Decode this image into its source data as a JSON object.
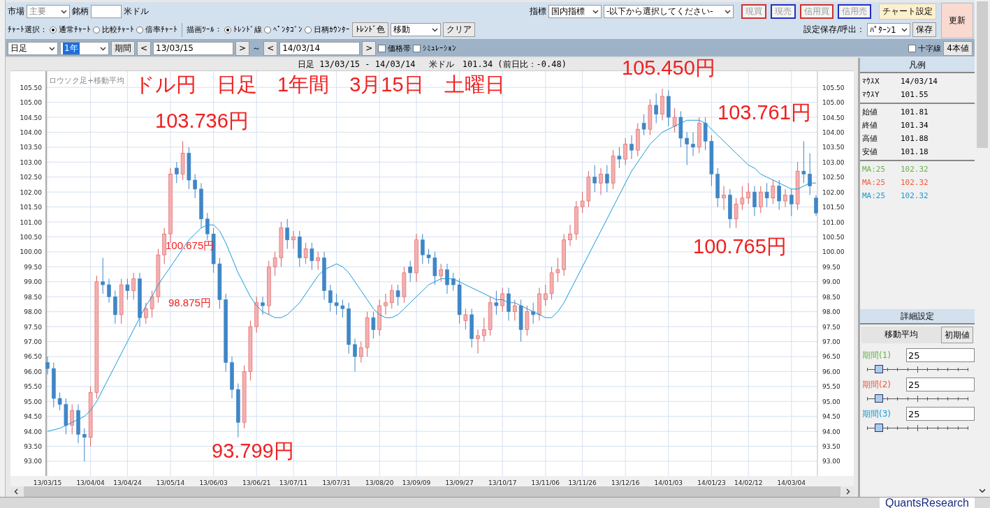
{
  "toolbar": {
    "market_label": "市場",
    "market": {
      "value": "主要",
      "disabled": true
    },
    "symbol_label": "銘柄",
    "symbol_name": "米ドル",
    "indicator_label": "指標",
    "indicator_selects": [
      "国内指標",
      "-以下から選択してください-"
    ],
    "trade_buttons": [
      {
        "label": "現買",
        "color": "#d03030",
        "disabled": true
      },
      {
        "label": "現売",
        "color": "#2030c0",
        "disabled": true
      },
      {
        "label": "信用買",
        "color": "#d03030",
        "disabled": true
      },
      {
        "label": "信用売",
        "color": "#2030c0",
        "disabled": true
      }
    ],
    "chart_settings_button": "チャート設定",
    "refresh_button": "更新",
    "chart_select": {
      "label": "ﾁｬｰﾄ選択：",
      "options": [
        {
          "label": "通常ﾁｬｰﾄ",
          "selected": true
        },
        {
          "label": "比較ﾁｬｰﾄ",
          "selected": false
        },
        {
          "label": "倍率ﾁｬｰﾄ",
          "selected": false
        }
      ]
    },
    "draw_tool": {
      "label": "描画ﾂｰﾙ：",
      "options": [
        {
          "label": "ﾄﾚﾝﾄﾞ線",
          "selected": true
        },
        {
          "label": "ﾍﾟﾝﾀｺﾞﾝ",
          "selected": false
        },
        {
          "label": "日柄ｶｳﾝﾀｰ",
          "selected": false
        }
      ]
    },
    "trend_color_button": "ﾄﾚﾝﾄﾞ色",
    "mode_select": "移動",
    "clear_button": "クリア",
    "save_label": "設定保存/呼出：",
    "pattern_select": "ﾊﾟﾀｰﾝ1",
    "save_button": "保存",
    "interval_select": {
      "value": "日足",
      "highlighted": false
    },
    "span_select": {
      "value": "1年",
      "highlighted": true
    },
    "period_button": "期間",
    "prev_button": "<",
    "start_date": "13/03/15",
    "next_button": ">",
    "range_sep": "～",
    "start2_button": "<",
    "end_date": "14/03/14",
    "end2_button": ">",
    "checkboxes": [
      {
        "label": "価格帯",
        "checked": false
      },
      {
        "label": "ｼﾐｭﾚｰｼｮﾝ",
        "checked": false
      }
    ],
    "crosshair": {
      "label": "十字線",
      "checked": false
    },
    "ohlc_button": "4本値"
  },
  "chart": {
    "header": "日足 13/03/15 - 14/03/14　 米ドル　101.34 (前日比：-0.48)",
    "caption": "ロウソク足+移動平均",
    "chart_data": {
      "type": "candlestick",
      "ylim": [
        92.51,
        106.04
      ],
      "categories": [
        "13/03/15",
        null,
        null,
        null,
        null,
        null,
        null,
        "13/04/04",
        null,
        null,
        null,
        null,
        null,
        "13/04/24",
        null,
        null,
        null,
        null,
        null,
        null,
        "13/05/14",
        null,
        null,
        null,
        null,
        null,
        null,
        "13/06/03",
        null,
        null,
        null,
        null,
        null,
        null,
        "13/06/21",
        null,
        null,
        null,
        null,
        null,
        "13/07/11",
        null,
        null,
        null,
        null,
        null,
        null,
        "13/07/31",
        null,
        null,
        null,
        null,
        null,
        null,
        "13/08/20",
        null,
        null,
        null,
        null,
        null,
        "13/09/09",
        null,
        null,
        null,
        null,
        null,
        null,
        "13/09/27",
        null,
        null,
        null,
        null,
        null,
        null,
        "13/10/17",
        null,
        null,
        null,
        null,
        null,
        null,
        "13/11/06",
        null,
        null,
        null,
        null,
        null,
        "13/11/26",
        null,
        null,
        null,
        null,
        null,
        null,
        "13/12/16",
        null,
        null,
        null,
        null,
        null,
        null,
        "14/01/03",
        null,
        null,
        null,
        null,
        null,
        null,
        "14/01/23",
        null,
        null,
        null,
        null,
        null,
        "14/02/12",
        null,
        null,
        null,
        null,
        null,
        null,
        "14/03/04",
        null,
        null,
        null,
        null
      ],
      "ohlc": [
        [
          96.3,
          96.5,
          95.9,
          96.1
        ],
        [
          96.1,
          96.3,
          94.8,
          95.1
        ],
        [
          95.1,
          95.3,
          94.7,
          94.9
        ],
        [
          94.9,
          95.1,
          93.9,
          94.2
        ],
        [
          94.2,
          94.9,
          93.9,
          94.7
        ],
        [
          94.7,
          94.9,
          93.6,
          93.9
        ],
        [
          93.9,
          94.1,
          93.0,
          93.8
        ],
        [
          93.8,
          95.5,
          93.5,
          95.3
        ],
        [
          95.3,
          99.2,
          95.1,
          99.0
        ],
        [
          99.0,
          99.8,
          98.6,
          98.9
        ],
        [
          98.9,
          99.1,
          98.3,
          98.5
        ],
        [
          98.5,
          98.7,
          97.6,
          97.9
        ],
        [
          97.9,
          99.1,
          97.6,
          98.9
        ],
        [
          98.9,
          99.1,
          98.4,
          98.7
        ],
        [
          98.7,
          99.3,
          98.4,
          99.1
        ],
        [
          99.1,
          99.3,
          97.5,
          97.8
        ],
        [
          97.8,
          98.3,
          97.6,
          98.1
        ],
        [
          98.1,
          98.7,
          97.8,
          98.5
        ],
        [
          98.5,
          100.1,
          98.3,
          99.9
        ],
        [
          99.9,
          100.8,
          99.6,
          100.6
        ],
        [
          100.6,
          102.8,
          100.3,
          102.6
        ],
        [
          102.8,
          103.0,
          102.3,
          102.6
        ],
        [
          102.6,
          103.7,
          102.4,
          103.3
        ],
        [
          103.3,
          103.5,
          102.1,
          102.4
        ],
        [
          102.4,
          102.6,
          101.8,
          102.1
        ],
        [
          102.1,
          102.3,
          100.8,
          101.1
        ],
        [
          101.1,
          101.3,
          100.4,
          100.6
        ],
        [
          100.6,
          100.8,
          99.3,
          99.6
        ],
        [
          99.6,
          99.8,
          98.1,
          98.4
        ],
        [
          98.4,
          98.6,
          96.0,
          96.3
        ],
        [
          96.3,
          96.5,
          95.1,
          95.4
        ],
        [
          95.4,
          95.6,
          93.8,
          94.3
        ],
        [
          94.3,
          96.2,
          94.1,
          96.0
        ],
        [
          96.0,
          97.7,
          95.7,
          97.5
        ],
        [
          97.5,
          98.5,
          97.3,
          98.3
        ],
        [
          98.3,
          98.5,
          97.9,
          98.2
        ],
        [
          98.2,
          99.7,
          97.9,
          99.5
        ],
        [
          99.5,
          100.0,
          99.2,
          99.8
        ],
        [
          99.8,
          101.0,
          99.5,
          100.8
        ],
        [
          100.8,
          101.1,
          100.1,
          100.4
        ],
        [
          100.4,
          100.7,
          100.1,
          100.5
        ],
        [
          100.5,
          100.7,
          99.5,
          99.8
        ],
        [
          99.8,
          100.3,
          99.6,
          100.1
        ],
        [
          100.1,
          100.3,
          99.4,
          99.7
        ],
        [
          99.7,
          100.0,
          99.4,
          99.8
        ],
        [
          99.8,
          100.0,
          98.4,
          98.7
        ],
        [
          98.7,
          98.9,
          98.0,
          98.3
        ],
        [
          98.3,
          98.6,
          97.9,
          98.2
        ],
        [
          98.2,
          98.4,
          97.8,
          98.1
        ],
        [
          98.1,
          98.3,
          96.6,
          96.9
        ],
        [
          96.9,
          97.1,
          96.0,
          96.5
        ],
        [
          96.5,
          97.0,
          96.3,
          96.8
        ],
        [
          96.8,
          98.0,
          96.5,
          97.8
        ],
        [
          97.8,
          98.0,
          97.1,
          97.4
        ],
        [
          97.4,
          98.4,
          97.2,
          98.2
        ],
        [
          98.2,
          98.6,
          97.9,
          98.3
        ],
        [
          98.3,
          98.9,
          98.1,
          98.7
        ],
        [
          98.7,
          98.9,
          98.2,
          98.5
        ],
        [
          98.5,
          99.5,
          98.3,
          99.3
        ],
        [
          99.5,
          99.7,
          99.0,
          99.3
        ],
        [
          99.3,
          100.6,
          99.0,
          100.4
        ],
        [
          100.4,
          100.6,
          99.6,
          99.9
        ],
        [
          99.9,
          100.1,
          99.6,
          99.8
        ],
        [
          99.8,
          100.0,
          98.9,
          99.2
        ],
        [
          99.2,
          99.6,
          99.0,
          99.4
        ],
        [
          99.4,
          99.6,
          98.6,
          98.9
        ],
        [
          99.1,
          99.3,
          98.7,
          98.9
        ],
        [
          98.9,
          99.1,
          97.6,
          97.9
        ],
        [
          97.7,
          98.1,
          97.4,
          97.9
        ],
        [
          97.9,
          98.1,
          96.8,
          97.1
        ],
        [
          97.1,
          97.4,
          96.6,
          97.2
        ],
        [
          97.2,
          97.8,
          97.0,
          97.4
        ],
        [
          97.4,
          98.5,
          97.2,
          98.3
        ],
        [
          98.3,
          98.7,
          97.9,
          98.2
        ],
        [
          98.2,
          98.8,
          98.0,
          98.6
        ],
        [
          98.6,
          98.8,
          97.7,
          98.0
        ],
        [
          98.0,
          98.4,
          97.7,
          98.2
        ],
        [
          98.2,
          98.4,
          97.0,
          97.4
        ],
        [
          97.4,
          98.2,
          97.2,
          98.0
        ],
        [
          98.0,
          98.3,
          97.6,
          97.9
        ],
        [
          97.9,
          98.8,
          97.7,
          98.6
        ],
        [
          98.4,
          98.9,
          98.2,
          98.6
        ],
        [
          98.6,
          99.5,
          98.4,
          99.3
        ],
        [
          99.3,
          99.8,
          99.0,
          99.4
        ],
        [
          99.4,
          100.6,
          99.2,
          100.4
        ],
        [
          100.4,
          100.9,
          100.2,
          100.6
        ],
        [
          100.6,
          101.7,
          100.4,
          101.5
        ],
        [
          101.5,
          102.0,
          101.3,
          101.7
        ],
        [
          101.7,
          102.7,
          101.5,
          102.5
        ],
        [
          102.5,
          102.9,
          102.0,
          102.3
        ],
        [
          102.3,
          102.8,
          101.9,
          102.6
        ],
        [
          102.6,
          102.9,
          102.0,
          102.3
        ],
        [
          102.3,
          103.4,
          102.1,
          103.2
        ],
        [
          103.2,
          103.5,
          102.8,
          103.1
        ],
        [
          103.1,
          103.8,
          102.9,
          103.6
        ],
        [
          103.6,
          103.9,
          103.1,
          103.4
        ],
        [
          103.4,
          104.3,
          103.2,
          104.1
        ],
        [
          104.3,
          104.6,
          103.9,
          104.1
        ],
        [
          104.1,
          105.1,
          103.9,
          104.9
        ],
        [
          104.9,
          105.3,
          104.3,
          104.6
        ],
        [
          104.6,
          105.45,
          104.4,
          105.2
        ],
        [
          105.2,
          105.4,
          104.2,
          104.5
        ],
        [
          104.2,
          104.8,
          104.0,
          104.5
        ],
        [
          104.5,
          104.7,
          103.5,
          103.8
        ],
        [
          103.8,
          104.0,
          102.9,
          103.6
        ],
        [
          103.6,
          104.0,
          103.2,
          103.5
        ],
        [
          103.5,
          104.5,
          103.3,
          104.3
        ],
        [
          104.3,
          104.5,
          103.4,
          103.7
        ],
        [
          103.7,
          103.9,
          102.2,
          102.6
        ],
        [
          102.6,
          102.8,
          101.5,
          101.8
        ],
        [
          101.8,
          102.2,
          101.4,
          101.9
        ],
        [
          101.9,
          102.1,
          100.8,
          101.1
        ],
        [
          101.1,
          101.8,
          100.8,
          101.6
        ],
        [
          101.6,
          102.2,
          101.4,
          101.8
        ],
        [
          101.8,
          102.3,
          101.6,
          102.0
        ],
        [
          102.0,
          102.2,
          101.2,
          101.5
        ],
        [
          101.5,
          102.2,
          101.3,
          102.0
        ],
        [
          102.0,
          102.3,
          101.5,
          101.8
        ],
        [
          101.8,
          102.4,
          101.6,
          102.2
        ],
        [
          102.2,
          102.4,
          101.4,
          101.7
        ],
        [
          101.7,
          102.1,
          101.5,
          101.9
        ],
        [
          101.9,
          102.1,
          101.2,
          101.6
        ],
        [
          101.6,
          103.0,
          101.4,
          102.7
        ],
        [
          102.7,
          103.7,
          102.3,
          102.6
        ],
        [
          102.6,
          103.3,
          101.9,
          102.2
        ],
        [
          101.8,
          101.9,
          101.2,
          101.3
        ]
      ],
      "yticks": [
        {
          "value": 105.5,
          "label": "105.50"
        },
        {
          "value": 105,
          "label": "105.00"
        },
        {
          "value": 104.5,
          "label": "104.50"
        },
        {
          "value": 104,
          "label": "104.00"
        },
        {
          "value": 103.5,
          "label": "103.50"
        },
        {
          "value": 103,
          "label": "103.00"
        },
        {
          "value": 102.5,
          "label": "102.50"
        },
        {
          "value": 102,
          "label": "102.00"
        },
        {
          "value": 101.5,
          "label": "101.50"
        },
        {
          "value": 101,
          "label": "101.00"
        },
        {
          "value": 100.5,
          "label": "100.50"
        },
        {
          "value": 100,
          "label": "100.00"
        },
        {
          "value": 99.5,
          "label": "99.50"
        },
        {
          "value": 99,
          "label": "99.00"
        },
        {
          "value": 98.5,
          "label": "98.50"
        },
        {
          "value": 98,
          "label": "98.00"
        },
        {
          "value": 97.5,
          "label": "97.50"
        },
        {
          "value": 97,
          "label": "97.00"
        },
        {
          "value": 96.5,
          "label": "96.50"
        },
        {
          "value": 96,
          "label": "96.00"
        },
        {
          "value": 95.5,
          "label": "95.50"
        },
        {
          "value": 95,
          "label": "95.00"
        },
        {
          "value": 94.5,
          "label": "94.50"
        },
        {
          "value": 94,
          "label": "94.00"
        },
        {
          "value": 93.5,
          "label": "93.50"
        },
        {
          "value": 93,
          "label": "93.00"
        }
      ],
      "grid": true
    },
    "overlay": {
      "chart_data": {
        "type": "line",
        "ylim": [
          92.51,
          106.04
        ],
        "categories": [
          null,
          null,
          null,
          null,
          null,
          null,
          null,
          null,
          null,
          null,
          null,
          null,
          null,
          null,
          null,
          null,
          null,
          null,
          null,
          null,
          null,
          null,
          null,
          null,
          null,
          null,
          null,
          null,
          null,
          null,
          null,
          null,
          null,
          null,
          null,
          null,
          null,
          null,
          null,
          null,
          null,
          null,
          null,
          null,
          null,
          null,
          null,
          null,
          null,
          null,
          null,
          null,
          null,
          null,
          null,
          null,
          null,
          null,
          null,
          null,
          null,
          null,
          null,
          null,
          null,
          null,
          null,
          null,
          null,
          null,
          null,
          null,
          null,
          null,
          null,
          null,
          null,
          null,
          null,
          null,
          null,
          null,
          null,
          null,
          null,
          null,
          null,
          null,
          null,
          null,
          null,
          null,
          null,
          null,
          null,
          null,
          null,
          null,
          null,
          null,
          null,
          null,
          null,
          null,
          null,
          null,
          null,
          null,
          null,
          null,
          null,
          null,
          null,
          null,
          null,
          null,
          null,
          null,
          null,
          null,
          null,
          null,
          null,
          null,
          null,
          null
        ],
        "yticks": [
          {
            "value": 105.5,
            "label": "105.50"
          },
          {
            "value": 105,
            "label": "105.00"
          },
          {
            "value": 104.5,
            "label": "104.50"
          },
          {
            "value": 104,
            "label": "104.00"
          },
          {
            "value": 103.5,
            "label": "103.50"
          },
          {
            "value": 103,
            "label": "103.00"
          },
          {
            "value": 102.5,
            "label": "102.50"
          },
          {
            "value": 102,
            "label": "102.00"
          },
          {
            "value": 101.5,
            "label": "101.50"
          },
          {
            "value": 101,
            "label": "101.00"
          },
          {
            "value": 100.5,
            "label": "100.50"
          },
          {
            "value": 100,
            "label": "100.00"
          },
          {
            "value": 99.5,
            "label": "99.50"
          },
          {
            "value": 99,
            "label": "99.00"
          },
          {
            "value": 98.5,
            "label": "98.50"
          },
          {
            "value": 98,
            "label": "98.00"
          },
          {
            "value": 97.5,
            "label": "97.50"
          },
          {
            "value": 97,
            "label": "97.00"
          },
          {
            "value": 96.5,
            "label": "96.50"
          },
          {
            "value": 96,
            "label": "96.00"
          },
          {
            "value": 95.5,
            "label": "95.50"
          },
          {
            "value": 95,
            "label": "95.00"
          },
          {
            "value": 94.5,
            "label": "94.50"
          },
          {
            "value": 94,
            "label": "94.00"
          },
          {
            "value": 93.5,
            "label": "93.50"
          },
          {
            "value": 93,
            "label": "93.00"
          }
        ],
        "series": [
          {
            "name": "MA:25",
            "color": "#1a9ad6",
            "values": [
              94.0,
              94.05,
              94.1,
              94.2,
              94.3,
              94.4,
              94.5,
              94.7,
              95.0,
              95.4,
              95.8,
              96.2,
              96.6,
              97.0,
              97.4,
              97.8,
              98.2,
              98.5,
              98.9,
              99.2,
              99.5,
              99.8,
              100.1,
              100.4,
              100.6,
              100.8,
              100.9,
              100.9,
              100.7,
              100.3,
              99.8,
              99.3,
              98.9,
              98.5,
              98.2,
              98.0,
              97.9,
              97.8,
              97.8,
              97.9,
              98.1,
              98.3,
              98.6,
              98.9,
              99.2,
              99.4,
              99.5,
              99.6,
              99.5,
              99.3,
              99.0,
              98.7,
              98.4,
              98.1,
              97.9,
              97.8,
              97.8,
              97.9,
              98.1,
              98.3,
              98.5,
              98.7,
              98.9,
              99.0,
              99.1,
              99.1,
              99.1,
              99.0,
              98.9,
              98.8,
              98.7,
              98.6,
              98.5,
              98.4,
              98.4,
              98.3,
              98.3,
              98.2,
              98.1,
              98.0,
              97.9,
              97.8,
              97.8,
              98.0,
              98.3,
              98.7,
              99.1,
              99.5,
              99.9,
              100.3,
              100.7,
              101.1,
              101.5,
              101.9,
              102.3,
              102.7,
              103.0,
              103.3,
              103.6,
              103.8,
              104.0,
              104.1,
              104.2,
              104.3,
              104.4,
              104.4,
              104.4,
              104.3,
              104.1,
              103.9,
              103.7,
              103.5,
              103.3,
              103.1,
              102.9,
              102.8,
              102.6,
              102.5,
              102.4,
              102.3,
              102.2,
              102.1,
              102.1,
              102.2,
              102.3,
              102.3
            ]
          }
        ]
      }
    },
    "annotations": [
      {
        "text": "ドル円　日足　1年間　3月15日　土曜日",
        "kind": "large"
      },
      {
        "text": "103.736円",
        "kind": "large"
      },
      {
        "text": "100.675円",
        "kind": "small"
      },
      {
        "text": "98.875円",
        "kind": "small"
      },
      {
        "text": "93.799円",
        "kind": "large"
      },
      {
        "text": "105.450円",
        "kind": "large"
      },
      {
        "text": "103.761円",
        "kind": "large"
      },
      {
        "text": "100.765円",
        "kind": "large"
      }
    ]
  },
  "legend": {
    "title": "凡例",
    "groups": [
      [
        {
          "label": "ﾏｳｽX",
          "value": "14/03/14"
        },
        {
          "label": "ﾏｳｽY",
          "value": "101.55"
        }
      ],
      [
        {
          "label": "始値",
          "value": "101.81"
        },
        {
          "label": "終値",
          "value": "101.34"
        },
        {
          "label": "高値",
          "value": "101.88"
        },
        {
          "label": "安値",
          "value": "101.18"
        }
      ],
      [
        {
          "label": "MA:25",
          "value": "102.32",
          "color": "#6ab04c"
        },
        {
          "label": "MA:25",
          "value": "102.32",
          "color": "#f05a3c"
        },
        {
          "kind": "series",
          "value": "102.32",
          "color": "#1a9ad6"
        }
      ]
    ]
  },
  "details": {
    "title": "詳細設定",
    "tabs": [
      {
        "label": "移動平均",
        "selected": true
      }
    ],
    "reset_button": "初期値",
    "periods": [
      {
        "label": "期間(1)",
        "value": "25",
        "color": "#6ab04c",
        "level": 0.12
      },
      {
        "label": "期間(2)",
        "value": "25",
        "color": "#f05a3c",
        "level": 0.12
      },
      {
        "label": "期間(3)",
        "value": "25",
        "color": "#1a9ad6",
        "level": 0.12
      }
    ]
  },
  "logo": "QuantsResearch"
}
